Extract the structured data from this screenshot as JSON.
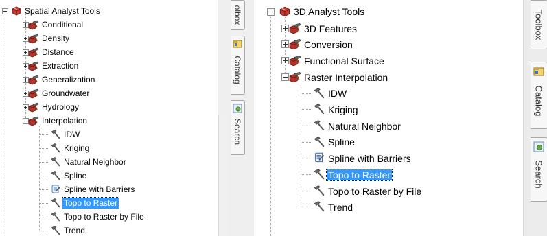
{
  "left_tree": {
    "root_label": "Spatial Analyst Tools",
    "toolsets": [
      {
        "label": "Conditional",
        "expanded": false
      },
      {
        "label": "Density",
        "expanded": false
      },
      {
        "label": "Distance",
        "expanded": false
      },
      {
        "label": "Extraction",
        "expanded": false
      },
      {
        "label": "Generalization",
        "expanded": false
      },
      {
        "label": "Groundwater",
        "expanded": false
      },
      {
        "label": "Hydrology",
        "expanded": false
      },
      {
        "label": "Interpolation",
        "expanded": true
      }
    ],
    "tools": [
      {
        "label": "IDW",
        "icon": "hammer-icon",
        "selected": false
      },
      {
        "label": "Kriging",
        "icon": "hammer-icon",
        "selected": false
      },
      {
        "label": "Natural Neighbor",
        "icon": "hammer-icon",
        "selected": false
      },
      {
        "label": "Spline",
        "icon": "hammer-icon",
        "selected": false
      },
      {
        "label": "Spline with Barriers",
        "icon": "script-icon",
        "selected": false
      },
      {
        "label": "Topo to Raster",
        "icon": "hammer-icon",
        "selected": true
      },
      {
        "label": "Topo to Raster by File",
        "icon": "hammer-icon",
        "selected": false
      },
      {
        "label": "Trend",
        "icon": "hammer-icon",
        "selected": false
      }
    ]
  },
  "right_tree": {
    "root_label": "3D Analyst Tools",
    "toolsets": [
      {
        "label": "3D Features",
        "expanded": false
      },
      {
        "label": "Conversion",
        "expanded": false
      },
      {
        "label": "Functional Surface",
        "expanded": false
      },
      {
        "label": "Raster Interpolation",
        "expanded": true
      }
    ],
    "tools": [
      {
        "label": "IDW",
        "icon": "hammer-icon",
        "selected": false
      },
      {
        "label": "Kriging",
        "icon": "hammer-icon",
        "selected": false
      },
      {
        "label": "Natural Neighbor",
        "icon": "hammer-icon",
        "selected": false
      },
      {
        "label": "Spline",
        "icon": "hammer-icon",
        "selected": false
      },
      {
        "label": "Spline with Barriers",
        "icon": "script-icon",
        "selected": false
      },
      {
        "label": "Topo to Raster",
        "icon": "hammer-icon",
        "selected": true
      },
      {
        "label": "Topo to Raster by File",
        "icon": "hammer-icon",
        "selected": false
      },
      {
        "label": "Trend",
        "icon": "hammer-icon",
        "selected": false
      }
    ]
  },
  "left_side_tabs": {
    "toolbox": "olbox",
    "catalog": "Catalog",
    "search": "Search"
  },
  "right_side_tabs": {
    "toolbox": "Toolbox",
    "catalog": "Catalog",
    "search": "Search"
  },
  "colors": {
    "selection": "#3399ff",
    "toolbox_red": "#b5262b",
    "hammer_gray": "#5a5a5a"
  }
}
